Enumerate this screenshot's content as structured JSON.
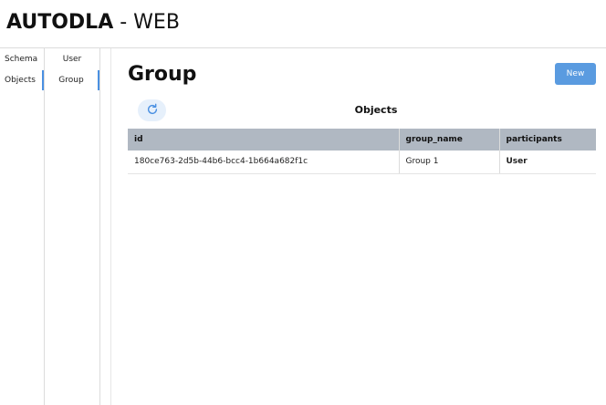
{
  "app": {
    "brand": "AUTODLA",
    "separator": " - ",
    "suffix": "WEB"
  },
  "nav": {
    "col1": [
      {
        "label": "Schema"
      },
      {
        "label": "Objects"
      }
    ],
    "col2": [
      {
        "label": "User"
      },
      {
        "label": "Group"
      }
    ]
  },
  "main": {
    "title": "Group",
    "new_label": "New",
    "section_title": "Objects",
    "refresh_icon": "refresh-icon",
    "columns": [
      "id",
      "group_name",
      "participants"
    ],
    "rows": [
      [
        "180ce763-2d5b-44b6-bcc4-1b664a682f1c",
        "Group 1",
        "User"
      ]
    ]
  },
  "colors": {
    "accent": "#5a9be0",
    "header_bg": "#b0b8c2",
    "refresh_bg": "#e6f0fb"
  }
}
